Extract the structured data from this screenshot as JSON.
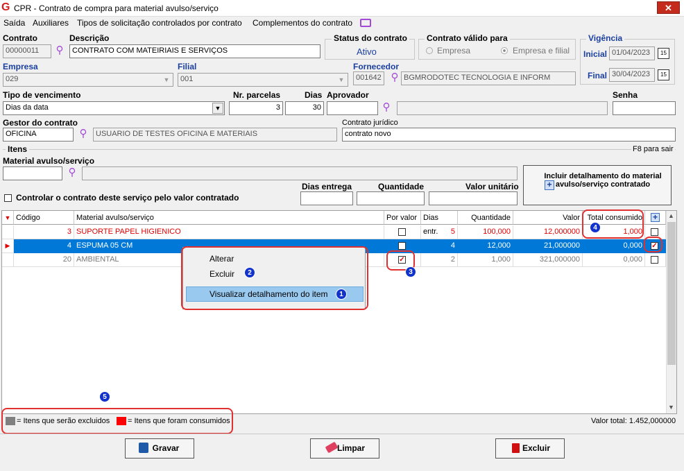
{
  "window": {
    "title": "CPR - Contrato de compra para material avulso/serviço",
    "logo": "G",
    "close": "✕"
  },
  "menu": {
    "items": [
      "Saída",
      "Auxiliares",
      "Tipos de solicitação controlados por contrato",
      "Complementos do contrato"
    ]
  },
  "form": {
    "contrato_label": "Contrato",
    "contrato_value": "00000011",
    "descricao_label": "Descrição",
    "descricao_value": "CONTRATO COM MATEIRIAIS E SERVIÇOS",
    "status_label": "Status do contrato",
    "status_value": "Ativo",
    "valido_label": "Contrato válido para",
    "valido_opt1": "Empresa",
    "valido_opt2": "Empresa e filial",
    "vigencia_label": "Vigência",
    "inicial_label": "Inicial",
    "inicial_value": "01/04/2023",
    "final_label": "Final",
    "final_value": "30/04/2023",
    "empresa_label": "Empresa",
    "empresa_value": "029",
    "filial_label": "Filial",
    "filial_value": "001",
    "fornecedor_label": "Fornecedor",
    "fornecedor_code": "001642",
    "fornecedor_name": "BGMRODOTEC TECNOLOGIA E INFORM",
    "tipo_venc_label": "Tipo de vencimento",
    "tipo_venc_value": "Dias da data",
    "parcelas_label": "Nr. parcelas",
    "parcelas_value": "3",
    "dias_label": "Dias",
    "dias_value": "30",
    "aprovador_label": "Aprovador",
    "senha_label": "Senha",
    "gestor_label": "Gestor do contrato",
    "gestor_code": "OFICINA",
    "gestor_name": "USUARIO DE TESTES OFICINA E MATERIAIS",
    "juridico_label": "Contrato jurídico",
    "juridico_value": "contrato novo"
  },
  "itens": {
    "section_label": "Itens",
    "f8_hint": "F8 para sair",
    "material_label": "Material avulso/serviço",
    "controlar_label": "Controlar o contrato deste serviço pelo valor contratado",
    "dias_entrega_label": "Dias entrega",
    "quantidade_label": "Quantidade",
    "valor_unit_label": "Valor unitário",
    "incluir_button": "Incluir detalhamento do material avulso/serviço contratado"
  },
  "grid": {
    "columns": [
      "Código",
      "Material avulso/serviço",
      "Por valor",
      "Dias entr.",
      "Quantidade",
      "Valor",
      "Total consumido"
    ],
    "rows": [
      {
        "codigo": "3",
        "material": "SUPORTE PAPEL HIGIENICO",
        "por_valor": false,
        "dias": "5",
        "quantidade": "100,000",
        "valor": "12,000000",
        "total": "1,000",
        "sel": false,
        "style": "consumed"
      },
      {
        "codigo": "4",
        "material": "ESPUMA 05 CM",
        "por_valor": false,
        "dias": "4",
        "quantidade": "12,000",
        "valor": "21,000000",
        "total": "0,000",
        "sel": true,
        "style": "selected"
      },
      {
        "codigo": "20",
        "material": "AMBIENTAL",
        "por_valor": true,
        "dias": "2",
        "quantidade": "1,000",
        "valor": "321,000000",
        "total": "0,000",
        "sel": false,
        "style": "excluded"
      }
    ]
  },
  "context_menu": {
    "alterar": "Alterar",
    "excluir": "Excluir",
    "visualizar": "Visualizar detalhamento do item"
  },
  "legend": {
    "excluded": "= Itens que serão excluidos",
    "consumed": "= Itens que foram consumidos",
    "excluded_color": "#808080",
    "consumed_color": "#ff0000"
  },
  "valor_total": "Valor total: 1.452,000000",
  "buttons": {
    "gravar": "Gravar",
    "limpar": "Limpar",
    "excluir": "Excluir"
  },
  "badges": [
    "1",
    "2",
    "3",
    "4",
    "5"
  ]
}
